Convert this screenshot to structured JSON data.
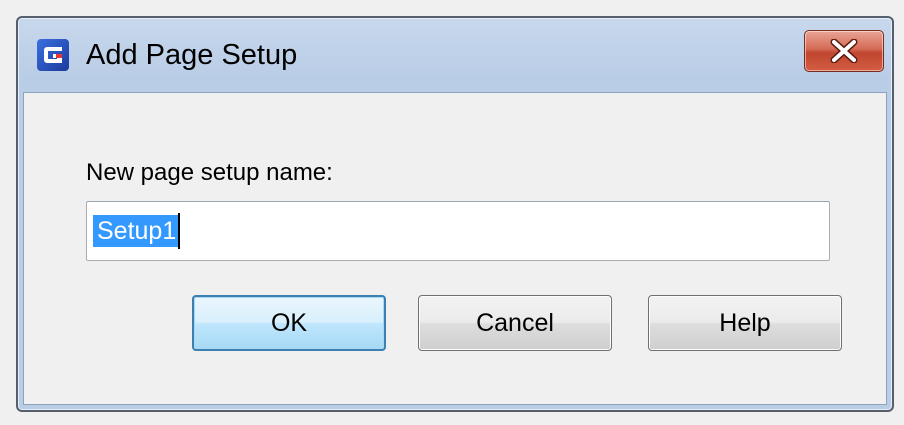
{
  "dialog": {
    "title": "Add Page Setup",
    "close_icon": "close-icon",
    "app_icon": "app-logo-icon",
    "colors": {
      "selection": "#3399ff",
      "close_button": "#c8503a",
      "default_button_border": "#3c7fb1"
    }
  },
  "form": {
    "label": "New page setup name:",
    "name_value": "Setup1"
  },
  "buttons": {
    "ok": "OK",
    "cancel": "Cancel",
    "help": "Help"
  }
}
